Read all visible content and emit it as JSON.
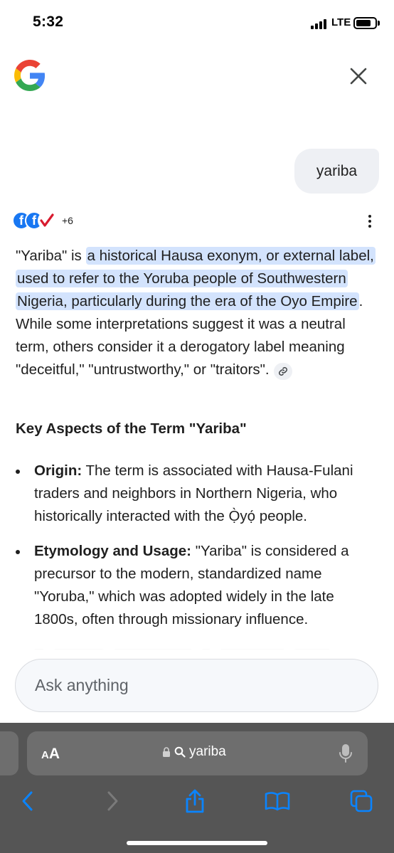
{
  "status_bar": {
    "time": "5:32",
    "network": "LTE",
    "battery_level": 0.78
  },
  "header": {
    "logo_icon": "google-g-icon",
    "close_icon": "close-icon"
  },
  "query": {
    "text": "yariba"
  },
  "sources": {
    "icons": [
      "facebook-icon",
      "facebook-icon",
      "checkmark-icon"
    ],
    "more_count": "+6"
  },
  "answer": {
    "lead": "\"Yariba\" is",
    "highlight": "a historical Hausa exonym, or external label, used to refer to the Yoruba people of Southwestern Nigeria, particularly during the era of the Oyo Empire",
    "rest": ". While some interpretations suggest it was a neutral term, others consider it a derogatory label meaning \"deceitful,\" \"untrustworthy,\" or \"traitors\"."
  },
  "section": {
    "heading": "Key Aspects of the Term \"Yariba\""
  },
  "bullets": [
    {
      "label": "Origin:",
      "text": " The term is associated with Hausa-Fulani traders and neighbors in Northern Nigeria, who historically interacted with the Ọ̀yọ́ people."
    },
    {
      "label": "Etymology and Usage:",
      "text": " \"Yariba\" is considered a precursor to the modern, standardized name \"Yoruba,\" which was adopted widely in the late 1800s, often through missionary influence."
    }
  ],
  "ask_bar": {
    "placeholder": "Ask anything"
  },
  "safari": {
    "aa_small": "A",
    "aa_big": "A",
    "url": "yariba",
    "nav_icons": [
      "back-icon",
      "forward-icon",
      "share-icon",
      "bookmarks-icon",
      "tabs-icon"
    ]
  },
  "colors": {
    "highlight": "#d3e3fd",
    "toolbar": "#555555",
    "accent_blue": "#0a84ff"
  }
}
